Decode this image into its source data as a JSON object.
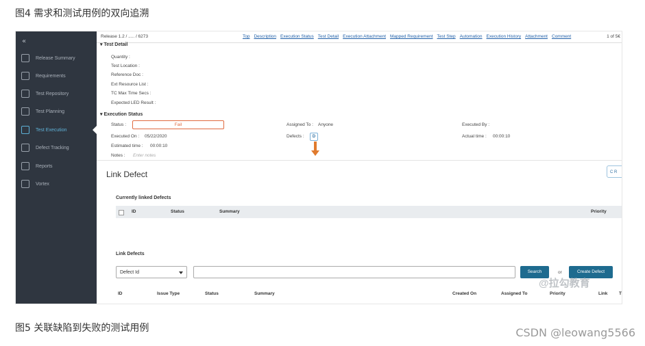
{
  "captions": {
    "top": "图4 需求和测试用例的双向追溯",
    "bottom": "图5 关联缺陷到失败的测试用例"
  },
  "watermark": "CSDN @leowang5566",
  "sidebar": {
    "collapse": "«",
    "items": [
      {
        "label": "Release Summary",
        "icon": "release-icon"
      },
      {
        "label": "Requirements",
        "icon": "requirements-icon"
      },
      {
        "label": "Test Repository",
        "icon": "repository-icon"
      },
      {
        "label": "Test Planning",
        "icon": "planning-icon"
      },
      {
        "label": "Test Execution",
        "icon": "execution-icon",
        "active": true
      },
      {
        "label": "Defect Tracking",
        "icon": "defect-icon"
      },
      {
        "label": "Reports",
        "icon": "reports-icon"
      },
      {
        "label": "Vortex",
        "icon": "vortex-icon"
      }
    ]
  },
  "topbar": {
    "breadcrumb": "Release 1.2 / ..... / 6273",
    "links": [
      "Top",
      "Description",
      "Execution Status",
      "Test Detail",
      "Execution Attachment",
      "Mapped Requirement",
      "Test Step",
      "Automation",
      "Execution History",
      "Attachment",
      "Comment"
    ],
    "pager": "1 of 5€"
  },
  "test_detail": {
    "heading": "Test Detail",
    "fields": [
      "Quantity :",
      "Test Location :",
      "Reference Doc :",
      "Ext Resource List :",
      "TC Max Time Secs :",
      "Expected LED Result :"
    ]
  },
  "execution_status": {
    "heading": "Execution Status",
    "status_label": "Status :",
    "status_value": "Fail",
    "assigned_to_label": "Assigned To :",
    "assigned_to_value": "Anyone",
    "executed_by_label": "Executed By :",
    "executed_on_label": "Executed On :",
    "executed_on_value": "05/22/2020",
    "defects_label": "Defects :",
    "defects_badge": "D",
    "actual_time_label": "Actual time :",
    "actual_time_value": "00:00:10",
    "estimated_time_label": "Estimated time :",
    "estimated_time_value": "00:00:10",
    "notes_label": "Notes :",
    "notes_placeholder": "Enter notes"
  },
  "link_defect": {
    "title": "Link Defect",
    "refresh": "C R",
    "currently_linked": "Currently linked Defects",
    "linked_columns": [
      "ID",
      "Status",
      "Summary",
      "Priority"
    ],
    "link_defects": "Link Defects",
    "select_value": "Defect Id",
    "search_button": "Search",
    "or": "or",
    "create_button": "Create Defect",
    "result_columns": [
      "ID",
      "Issue Type",
      "Status",
      "Summary",
      "Created On",
      "Assigned To",
      "Priority",
      "Link",
      "T"
    ],
    "watermark": "@拉勾教育"
  }
}
